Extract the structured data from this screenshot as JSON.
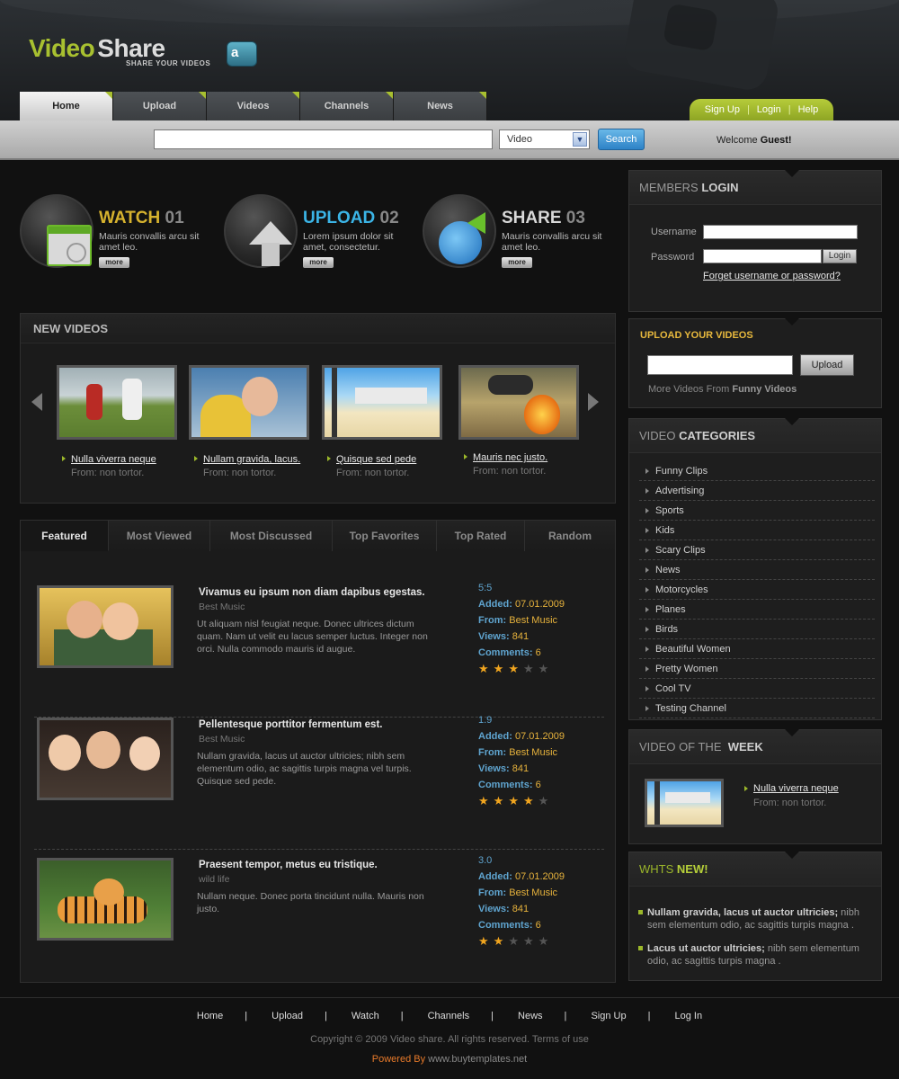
{
  "colors": {
    "accent_green": "#a8c030",
    "accent_yellow": "#e6b23c",
    "link_blue": "#5fa4cf"
  },
  "logo": {
    "word1": "Video",
    "word2": "Share",
    "tagline": "SHARE YOUR VIDEOS",
    "badge": "a"
  },
  "nav": {
    "tabs": [
      "Home",
      "Upload",
      "Videos",
      "Channels",
      "News"
    ],
    "active": "Home"
  },
  "util": {
    "signup": "Sign Up",
    "login": "Login",
    "help": "Help",
    "sep": "|"
  },
  "search": {
    "select_value": "Video",
    "button": "Search",
    "welcome_prefix": "Welcome",
    "welcome_user": "Guest!"
  },
  "features": [
    {
      "title": "WATCH",
      "num": "01",
      "desc": "Mauris convallis arcu sit amet leo.",
      "more": "more",
      "color": "#d6b22e",
      "icon": "watch-icon"
    },
    {
      "title": "UPLOAD",
      "num": "02",
      "desc": "Lorem ipsum dolor sit amet, consectetur.",
      "more": "more",
      "color": "#3bb4e6",
      "icon": "upload-arrow-icon"
    },
    {
      "title": "SHARE",
      "num": "03",
      "desc": "Mauris convallis arcu sit amet leo.",
      "more": "more",
      "color": "#d8d8d8",
      "icon": "globe-share-icon"
    }
  ],
  "new_videos": {
    "heading": "NEW VIDEOS",
    "items": [
      {
        "title": "Nulla viverra neque",
        "from": "From: non tortor."
      },
      {
        "title": "Nullam gravida, lacus.",
        "from": "From: non tortor."
      },
      {
        "title": "Quisque sed pede",
        "from": "From: non tortor."
      },
      {
        "title": "Mauris nec justo.",
        "from": "From: non tortor."
      }
    ]
  },
  "tabs": [
    "Featured",
    "Most Viewed",
    "Most Discussed",
    "Top Favorites",
    "Top Rated",
    "Random"
  ],
  "listing": {
    "labels": {
      "added": "Added:",
      "from": "From:",
      "views": "Views:",
      "comments": "Comments:"
    },
    "items": [
      {
        "title": "Vivamus eu ipsum non diam dapibus egestas.",
        "category": "Best Music",
        "desc": "Ut aliquam nisl feugiat neque. Donec ultrices dictum quam. Nam ut velit eu lacus semper luctus. Integer non orci. Nulla commodo mauris id augue.",
        "duration": "5:5",
        "added": "07.01.2009",
        "from": "Best Music",
        "views": "841",
        "comments": "6",
        "rating": 3
      },
      {
        "title": "Pellentesque porttitor fermentum est.",
        "category": "Best Music",
        "desc": "Nullam gravida, lacus ut auctor ultricies; nibh sem elementum odio, ac sagittis turpis magna vel turpis. Quisque sed pede.",
        "duration": "1.9",
        "added": "07.01.2009",
        "from": "Best Music",
        "views": "841",
        "comments": "6",
        "rating": 4
      },
      {
        "title": "Praesent tempor, metus eu tristique.",
        "category": "wild life",
        "desc": "Nullam neque. Donec porta tincidunt nulla. Mauris non justo.",
        "duration": "3.0",
        "added": "07.01.2009",
        "from": "Best Music",
        "views": "841",
        "comments": "6",
        "rating": 2
      }
    ]
  },
  "members_login": {
    "head_light": "MEMBERS",
    "head_bold": "LOGIN",
    "username_label": "Username",
    "password_label": "Password",
    "login_button": "Login",
    "forget": "Forget username or password?"
  },
  "upload_videos": {
    "title": "UPLOAD YOUR VIDEOS",
    "button": "Upload",
    "more_prefix": "More Videos From",
    "more_bold": "Funny Videos"
  },
  "categories": {
    "head_light": "VIDEO",
    "head_bold": "CATEGORIES",
    "items": [
      "Funny Clips",
      "Advertising",
      "Sports",
      "Kids",
      "Scary Clips",
      "News",
      "Motorcycles",
      "Planes",
      "Birds",
      "Beautiful Women",
      "Pretty Women",
      "Cool TV",
      "Testing Channel"
    ]
  },
  "video_of_week": {
    "head_light": "VIDEO OF THE",
    "head_bold": "WEEK",
    "title": "Nulla viverra neque",
    "from": "From: non tortor."
  },
  "whats_new": {
    "head_light": "WHTS",
    "head_bold": "NEW!",
    "items": [
      {
        "bold": "Nullam gravida, lacus ut auctor ultricies;",
        "rest": " nibh sem elementum odio, ac sagittis turpis magna ."
      },
      {
        "bold": "Lacus ut auctor ultricies;",
        "rest": " nibh sem elementum odio, ac sagittis turpis magna ."
      }
    ]
  },
  "footer": {
    "links": [
      "Home",
      "Upload",
      "Watch",
      "Channels",
      "News",
      "Sign Up",
      "Log In"
    ],
    "sep": "|",
    "copyright": "Copyright © 2009 Video share. All rights reserved. Terms of use",
    "powered_label": "Powered By",
    "powered_site": "www.buytemplates.net"
  }
}
